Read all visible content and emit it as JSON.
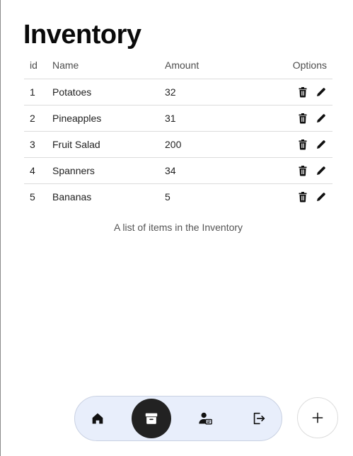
{
  "page": {
    "title": "Inventory"
  },
  "table": {
    "headers": {
      "id": "id",
      "name": "Name",
      "amount": "Amount",
      "options": "Options"
    },
    "rows": [
      {
        "id": "1",
        "name": "Potatoes",
        "amount": "32"
      },
      {
        "id": "2",
        "name": "Pineapples",
        "amount": "31"
      },
      {
        "id": "3",
        "name": "Fruit Salad",
        "amount": "200"
      },
      {
        "id": "4",
        "name": "Spanners",
        "amount": "34"
      },
      {
        "id": "5",
        "name": "Bananas",
        "amount": "5"
      }
    ],
    "caption": "A list of items in the Inventory",
    "row_actions": [
      "trash-icon",
      "pencil-icon"
    ]
  },
  "bottom_nav": {
    "items": [
      {
        "icon": "home-icon",
        "active": false
      },
      {
        "icon": "archive-icon",
        "active": true
      },
      {
        "icon": "user-card-icon",
        "active": false
      },
      {
        "icon": "logout-icon",
        "active": false
      }
    ],
    "fab_icon": "plus-icon"
  },
  "colors": {
    "nav_bg": "#e8eefb",
    "active_bg": "#222222",
    "text": "#1f1f1f"
  }
}
